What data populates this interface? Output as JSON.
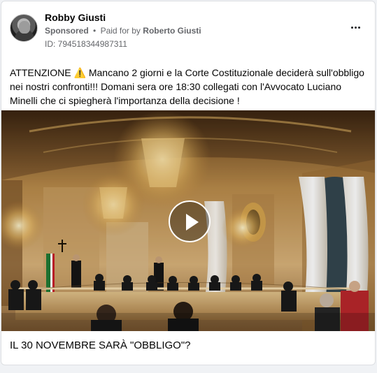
{
  "post": {
    "author": "Robby Giusti",
    "sponsored": "Sponsored",
    "separator": "•",
    "paid_for_prefix": "Paid for by",
    "payer": "Roberto Giusti",
    "ad_id": "ID: 794518344987311",
    "text": "ATTENZIONE ⚠️ Mancano 2 giorni e la Corte Costituzionale deciderà sull'obbligo nei nostri confronti!!! Domani sera ore 18:30 collegati con l'Avvocato Luciano Minelli che ci spiegherà l'importanza della decisione !",
    "headline": "IL 30 NOVEMBRE SARÀ \"OBBLIGO\"?"
  },
  "media": {
    "type": "video"
  },
  "icons": {
    "menu": "more-horizontal-icon",
    "play": "play-icon"
  },
  "colors": {
    "text_primary": "#050505",
    "text_secondary": "#65676b",
    "card_border": "#dddfe2"
  }
}
